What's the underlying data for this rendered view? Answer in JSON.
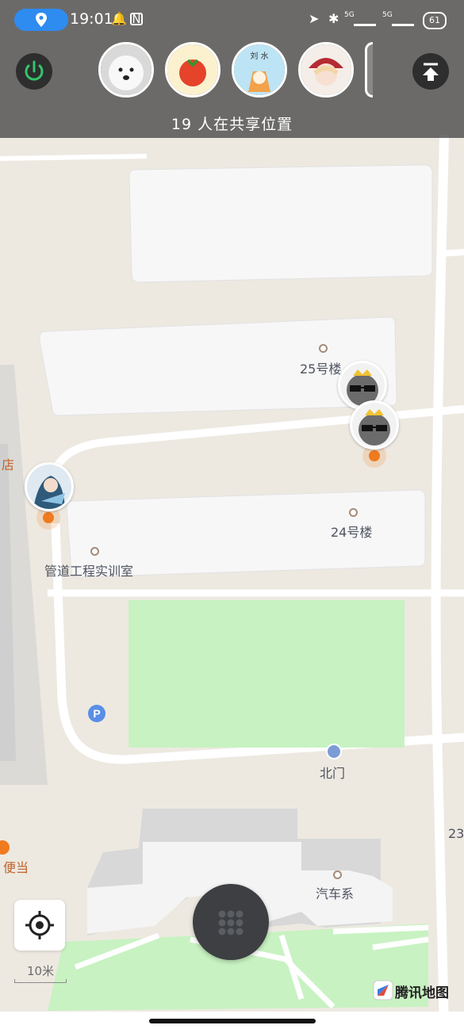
{
  "status_bar": {
    "time": "19:01",
    "battery": "61",
    "network_left": "5G",
    "network_right": "5G"
  },
  "header": {
    "sharing_text": "19 人在共享位置",
    "avatars": [
      {
        "name": "samoyed-avatar"
      },
      {
        "name": "tomato-avatar"
      },
      {
        "name": "corgi-avatar",
        "caption": "刘 水"
      },
      {
        "name": "anime-girl-avatar"
      }
    ]
  },
  "map": {
    "poi_labels": {
      "building25": "25号楼",
      "building24": "24号楼",
      "pipe_lab": "管道工程实训室",
      "north_gate": "北门",
      "auto_dept": "汽车系",
      "edge_store": "店",
      "edge_convenience": "便当",
      "edge_23": "23"
    },
    "parking_icon": "P",
    "scale_label": "10米",
    "provider": "腾讯地图"
  },
  "colors": {
    "accent_blue": "#2e8bf0",
    "marker_orange": "#f07a1e",
    "green_field": "#c8f2c2",
    "map_bg": "#ede9e1"
  }
}
